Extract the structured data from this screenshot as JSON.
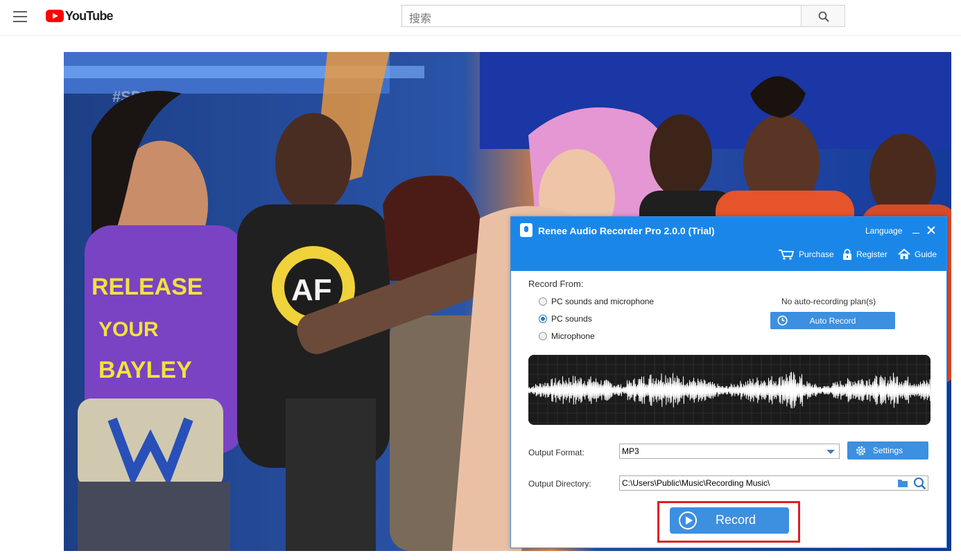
{
  "youtube": {
    "logo_text": "YouTube",
    "search_placeholder": "搜索"
  },
  "video": {
    "watermark": "#SDLive",
    "shirt_text": [
      "RELEASE",
      "YOUR",
      "BAYLEY"
    ]
  },
  "app": {
    "title": "Renee Audio Recorder Pro 2.0.0 (Trial)",
    "language": "Language",
    "nav": {
      "purchase": "Purchase",
      "register": "Register",
      "guide": "Guide"
    },
    "record_from_label": "Record From:",
    "sources": [
      {
        "label": "PC sounds and microphone",
        "selected": false
      },
      {
        "label": "PC sounds",
        "selected": true
      },
      {
        "label": "Microphone",
        "selected": false
      }
    ],
    "plan_status": "No auto-recording plan(s)",
    "auto_record": "Auto Record",
    "output_format_label": "Output Format:",
    "output_format_value": "MP3",
    "settings": "Settings",
    "output_dir_label": "Output Directory:",
    "output_dir_value": "C:\\Users\\Public\\Music\\Recording Music\\",
    "record": "Record",
    "accent_color": "#1a87e8",
    "highlight_color": "#e01e2a"
  }
}
